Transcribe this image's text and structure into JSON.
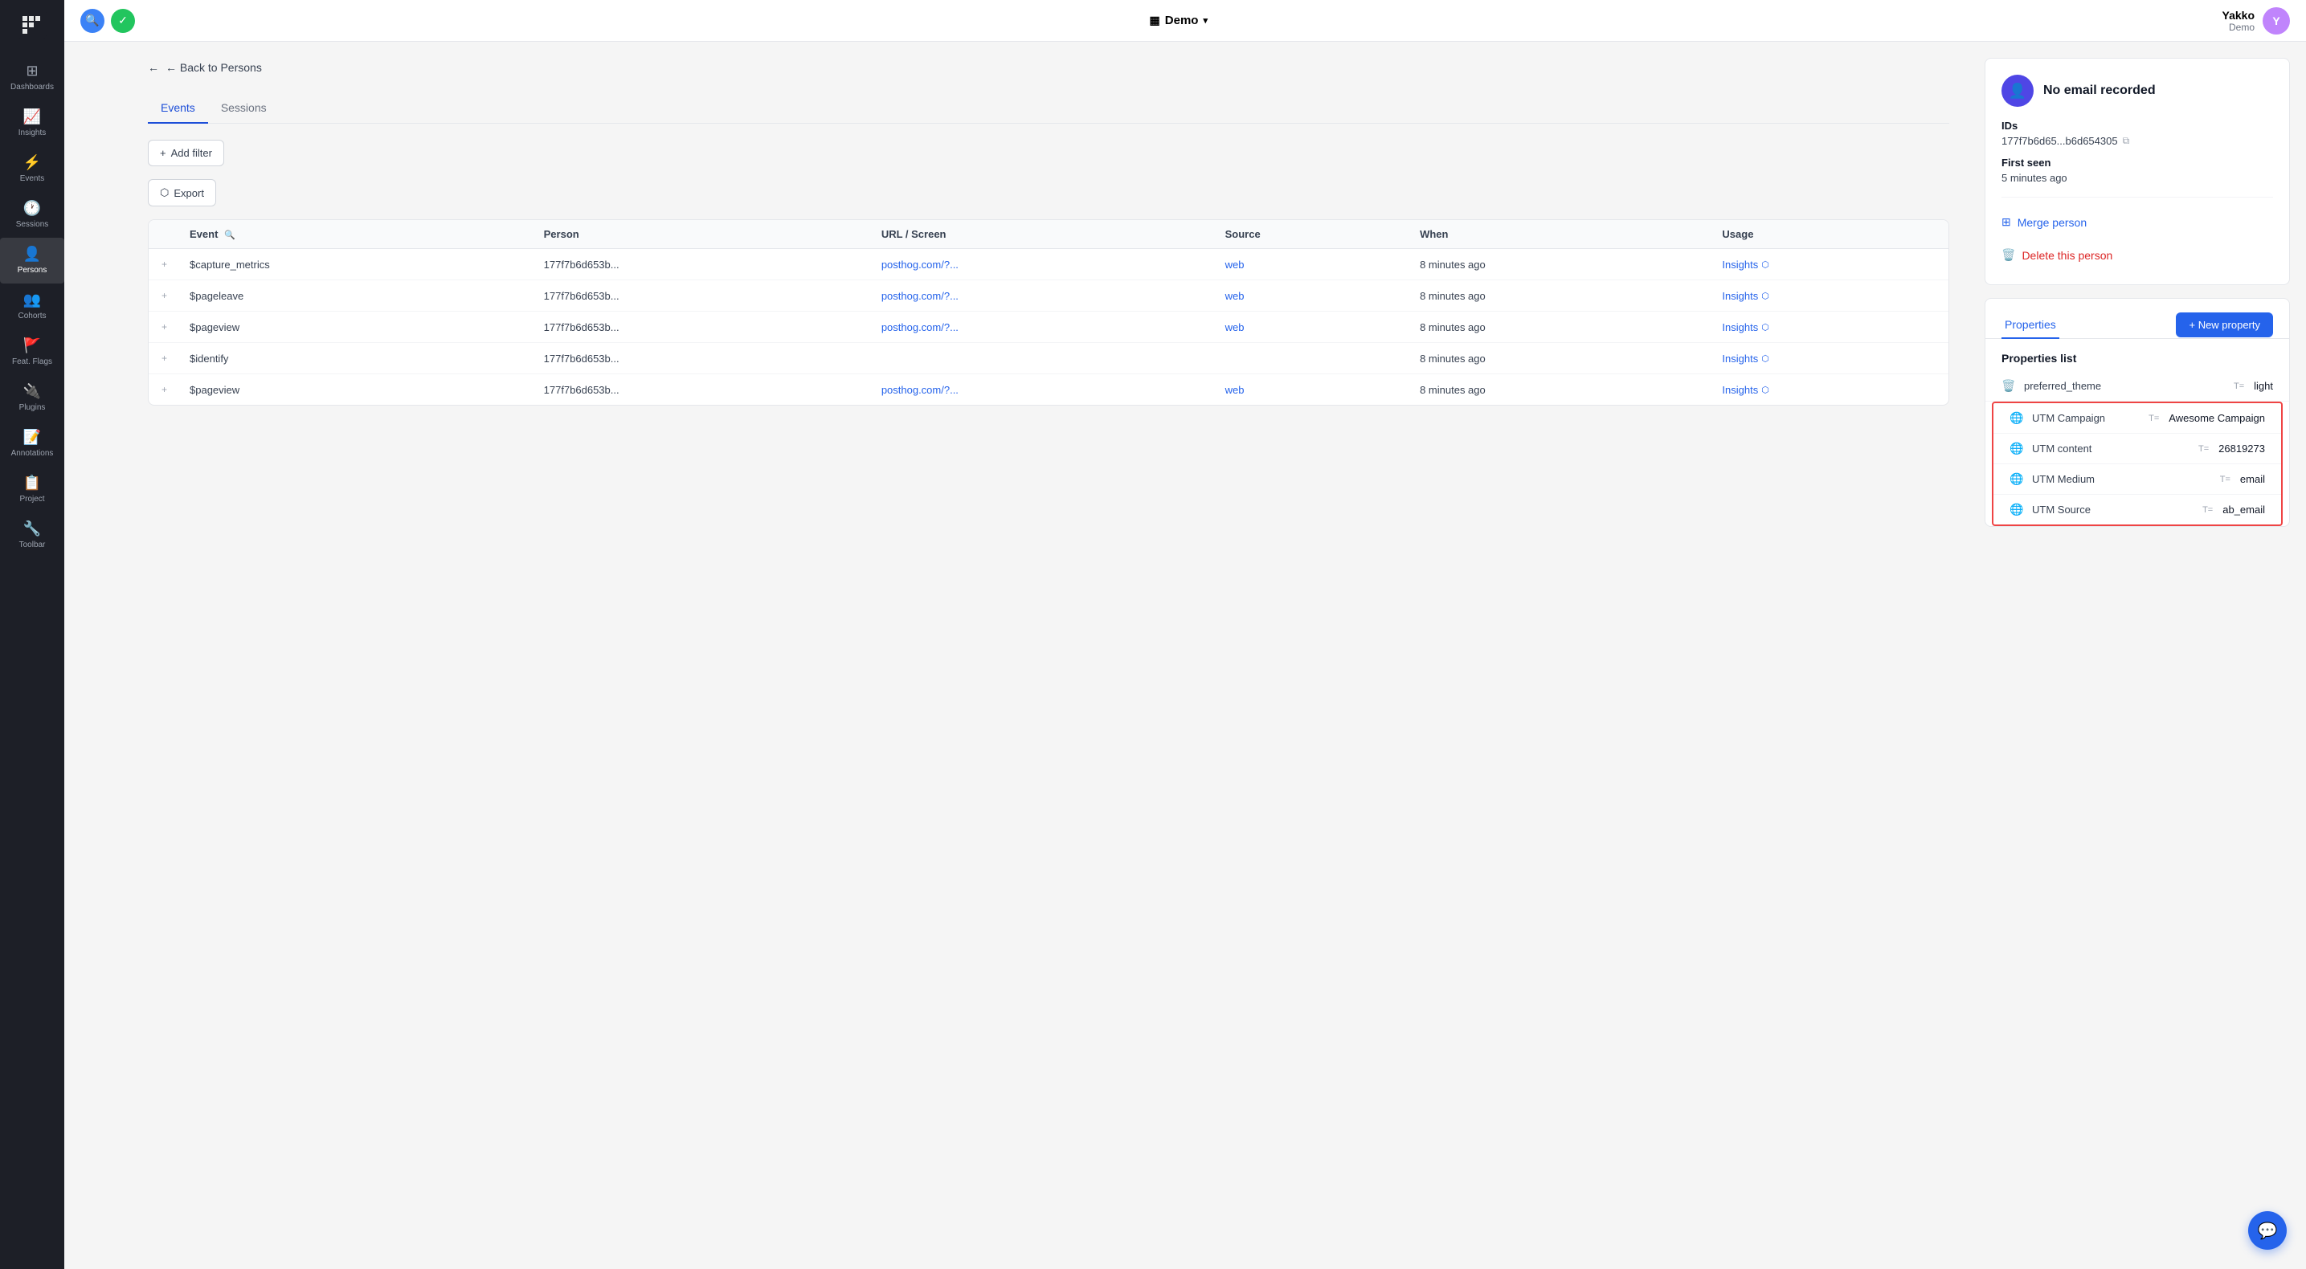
{
  "topbar": {
    "search_icon": "🔍",
    "status_icon": "✓",
    "project_name": "Demo",
    "user_name": "Yakko",
    "user_org": "Demo",
    "user_initial": "Y"
  },
  "sidebar": {
    "items": [
      {
        "id": "dashboards",
        "label": "Dashboards",
        "icon": "⊞",
        "active": false
      },
      {
        "id": "insights",
        "label": "Insights",
        "icon": "📈",
        "active": false
      },
      {
        "id": "events",
        "label": "Events",
        "icon": "⚡",
        "active": false
      },
      {
        "id": "sessions",
        "label": "Sessions",
        "icon": "🕐",
        "active": false
      },
      {
        "id": "persons",
        "label": "Persons",
        "icon": "👤",
        "active": true
      },
      {
        "id": "cohorts",
        "label": "Cohorts",
        "icon": "👥",
        "active": false
      },
      {
        "id": "feat-flags",
        "label": "Feat. Flags",
        "icon": "🚩",
        "active": false
      },
      {
        "id": "plugins",
        "label": "Plugins",
        "icon": "🔌",
        "active": false
      },
      {
        "id": "annotations",
        "label": "Annotations",
        "icon": "📝",
        "active": false
      },
      {
        "id": "project",
        "label": "Project",
        "icon": "📋",
        "active": false
      },
      {
        "id": "toolbar",
        "label": "Toolbar",
        "icon": "🔧",
        "active": false
      }
    ]
  },
  "breadcrumb": {
    "back_label": "← Back to Persons"
  },
  "tabs": {
    "items": [
      {
        "id": "events",
        "label": "Events",
        "active": true
      },
      {
        "id": "sessions",
        "label": "Sessions",
        "active": false
      }
    ]
  },
  "toolbar": {
    "add_filter_label": "Add filter",
    "export_label": "Export"
  },
  "events_table": {
    "columns": [
      "",
      "Event",
      "",
      "Person",
      "URL / Screen",
      "Source",
      "When",
      "Usage"
    ],
    "rows": [
      {
        "event": "$capture_metrics",
        "person": "177f7b6d653b...",
        "url": "posthog.com/?...",
        "source": "web",
        "when": "8 minutes ago",
        "usage": "Insights"
      },
      {
        "event": "$pageleave",
        "person": "177f7b6d653b...",
        "url": "posthog.com/?...",
        "source": "web",
        "when": "8 minutes ago",
        "usage": "Insights"
      },
      {
        "event": "$pageview",
        "person": "177f7b6d653b...",
        "url": "posthog.com/?...",
        "source": "web",
        "when": "8 minutes ago",
        "usage": "Insights"
      },
      {
        "event": "$identify",
        "person": "177f7b6d653b...",
        "url": "",
        "source": "",
        "when": "8 minutes ago",
        "usage": "Insights"
      },
      {
        "event": "$pageview",
        "person": "177f7b6d653b...",
        "url": "posthog.com/?...",
        "source": "web",
        "when": "8 minutes ago",
        "usage": "Insights"
      }
    ]
  },
  "person_card": {
    "no_email_label": "No email recorded",
    "ids_label": "IDs",
    "ids_value": "177f7b6d65...b6d654305",
    "first_seen_label": "First seen",
    "first_seen_value": "5 minutes ago",
    "merge_label": "Merge person",
    "delete_label": "Delete this person"
  },
  "properties_panel": {
    "tab_label": "Properties",
    "new_property_label": "+ New property",
    "list_header": "Properties list",
    "properties": [
      {
        "icon": "🗑️",
        "name": "preferred_theme",
        "type": "T=",
        "value": "light",
        "highlighted": false
      },
      {
        "icon": "🌐",
        "name": "UTM Campaign",
        "type": "T=",
        "value": "Awesome Campaign",
        "highlighted": true
      },
      {
        "icon": "🌐",
        "name": "UTM content",
        "type": "T=",
        "value": "26819273",
        "highlighted": true
      },
      {
        "icon": "🌐",
        "name": "UTM Medium",
        "type": "T=",
        "value": "email",
        "highlighted": true
      },
      {
        "icon": "🌐",
        "name": "UTM Source",
        "type": "T=",
        "value": "ab_email",
        "highlighted": true
      }
    ]
  },
  "chat_icon": "💬"
}
